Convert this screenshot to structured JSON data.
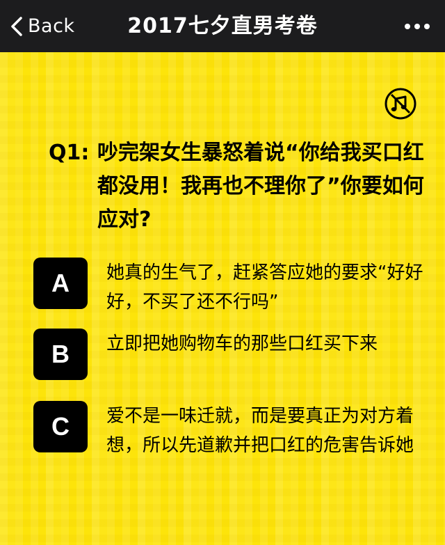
{
  "navbar": {
    "back_label": "Back",
    "title": "2017七夕直男考卷",
    "more_icon": "more-dots-icon"
  },
  "colors": {
    "navbar_bg": "#1c1c1e",
    "content_bg": "#fde40a",
    "badge_bg": "#000000",
    "text": "#000000"
  },
  "music_icon": "music-note-icon",
  "question": {
    "number": "Q1:",
    "text": "吵完架女生暴怒着说“你给我买口红都没用！我再也不理你了”你要如何应对?"
  },
  "options": [
    {
      "letter": "A",
      "text": "她真的生气了，赶紧答应她的要求“好好好，不买了还不行吗”"
    },
    {
      "letter": "B",
      "text": "立即把她购物车的那些口红买下来"
    },
    {
      "letter": "C",
      "text": "爱不是一味迁就，而是要真正为对方着想，所以先道歉并把口红的危害告诉她"
    }
  ]
}
